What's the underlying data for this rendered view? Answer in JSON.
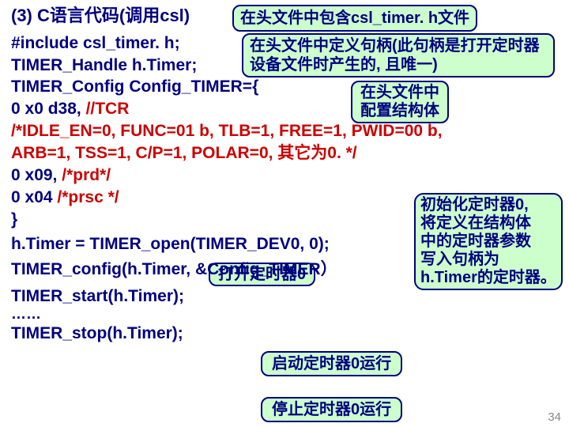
{
  "title": "(3) C语言代码(调用csl)",
  "callouts": {
    "header_include": "在头文件中包含csl_timer. h文件",
    "define_handle": "在头文件中定义句柄(此句柄是打开定时器设备文件时产生的, 且唯一)",
    "config_struct_l1": "在头文件中",
    "config_struct_l2": "配置结构体",
    "init_l1": "初始化定时器0,",
    "init_l2": "将定义在结构体",
    "init_l3": "中的定时器参数",
    "init_l4": "写入句柄为",
    "init_l5": "h.Timer的定时器。",
    "open_timer": "打开定时器0",
    "start_timer": "启动定时器0运行",
    "stop_timer": "停止定时器0运行"
  },
  "code": {
    "l01": "#include csl_timer. h;",
    "l02": "TIMER_Handle  h.Timer;",
    "l03": "TIMER_Config  Config_TIMER={",
    "l04a": "0 x0 d38,   ",
    "l04b": "//TCR",
    "l05": "/*IDLE_EN=0, FUNC=01 b, TLB=1, FREE=1, PWID=00 b,",
    "l06": "   ARB=1, TSS=1, C/P=1, POLAR=0, 其它为0. */",
    "l07a": "0 x09,   ",
    "l07b": "/*prd*/",
    "l08a": "0 x04   ",
    "l08b": "/*prsc */",
    "l09": "}",
    "l10": "h.Timer = TIMER_open(TIMER_DEV0, 0);",
    "l11": "TIMER_config(h.Timer, &Config_TIMER）",
    "l12": "TIMER_start(h.Timer);",
    "l13": " ……",
    "l14": "TIMER_stop(h.Timer);"
  },
  "page_number": "34"
}
